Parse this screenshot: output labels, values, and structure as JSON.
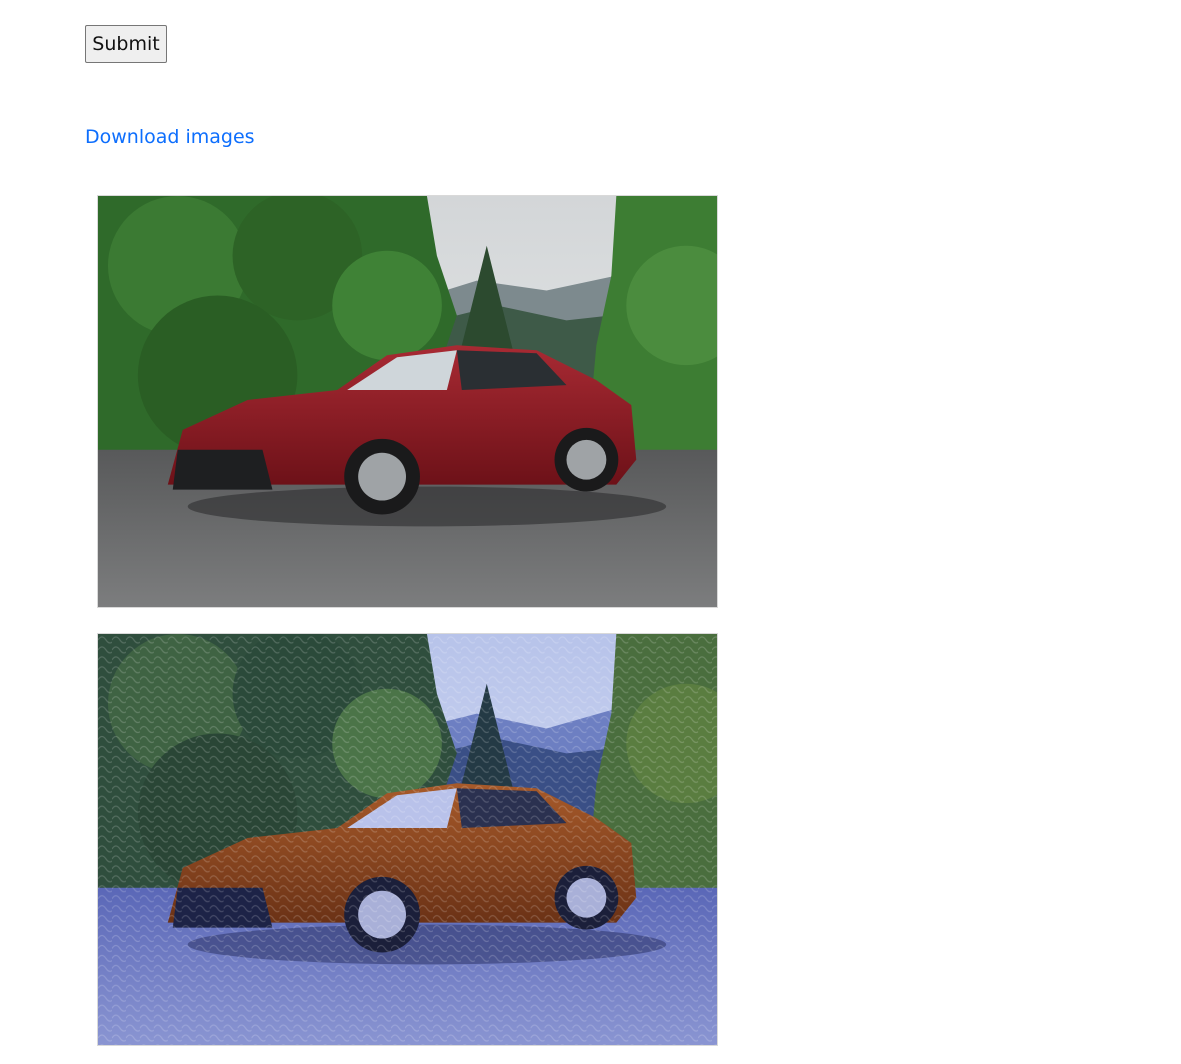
{
  "form": {
    "submit_label": "Submit"
  },
  "links": {
    "download_label": "Download images"
  },
  "images": [
    {
      "name": "original-car-photo",
      "palette": {
        "sky": "#dfe2e3",
        "trees": "#2f6a2a",
        "road": "#6a6b6c",
        "car": "#8e1b24"
      }
    },
    {
      "name": "styled-car-photo",
      "palette": {
        "sky": "#c9d2ee",
        "trees": "#2f4e3d",
        "road": "#6c78c4",
        "car": "#8a4320"
      }
    }
  ],
  "colors": {
    "link": "#0d6efd",
    "button_bg": "#efefef",
    "button_border": "#767676"
  }
}
